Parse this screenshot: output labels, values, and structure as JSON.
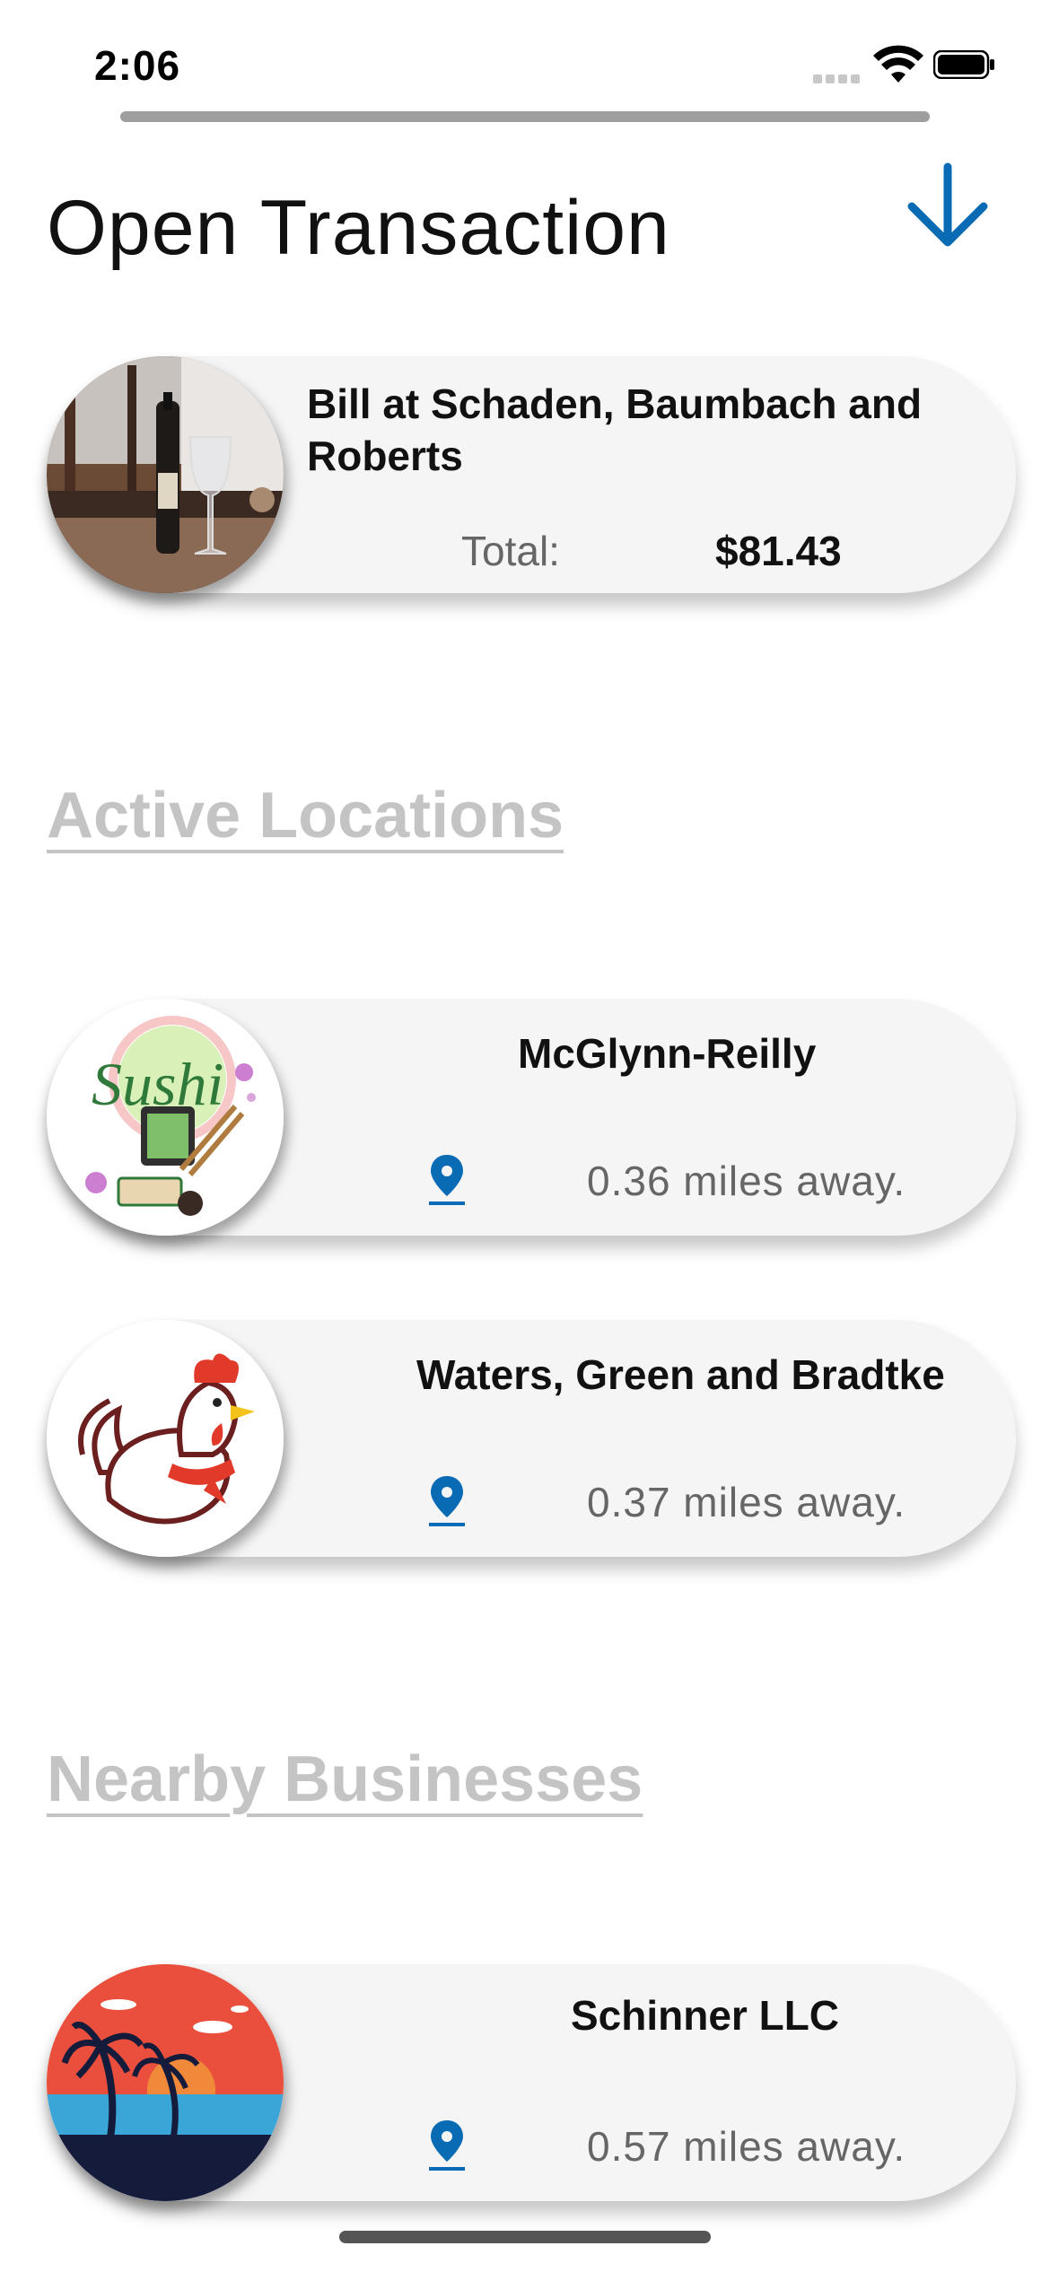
{
  "status_bar": {
    "time": "2:06"
  },
  "header": {
    "title": "Open Transaction",
    "collapse_icon": "arrow-down-icon"
  },
  "open_transaction": {
    "title": "Bill at Schaden, Baumbach and Roberts",
    "total_label": "Total:",
    "total_value": "$81.43"
  },
  "active_locations": {
    "heading": "Active Locations",
    "items": [
      {
        "name": "McGlynn-Reilly",
        "distance": "0.36 miles away.",
        "logo": "Sushi",
        "logo_text": "Sushi"
      },
      {
        "name": "Waters, Green and Bradtke",
        "distance": "0.37 miles away.",
        "logo": "rooster-icon"
      }
    ]
  },
  "nearby_businesses": {
    "heading": "Nearby Businesses",
    "items": [
      {
        "name": "Schinner LLC",
        "distance": "0.57 miles away.",
        "logo": "sunset-palm-icon"
      }
    ]
  },
  "colors": {
    "accent": "#0a6bb5",
    "section_heading": "#c4c4c4",
    "card_bg": "#f5f5f5"
  }
}
